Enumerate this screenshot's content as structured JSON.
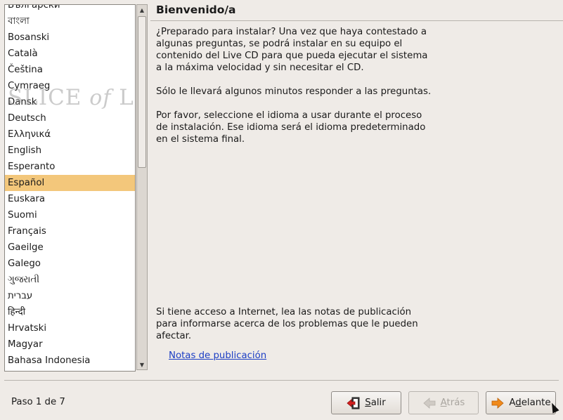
{
  "languages": {
    "items": [
      "Български",
      "বাংলা",
      "Bosanski",
      "Català",
      "Čeština",
      "Cymraeg",
      "Dansk",
      "Deutsch",
      "Ελληνικά",
      "English",
      "Esperanto",
      "Español",
      "Euskara",
      "Suomi",
      "Français",
      "Gaeilge",
      "Galego",
      "ગુજરાતી",
      "עברית",
      "हिन्दी",
      "Hrvatski",
      "Magyar",
      "Bahasa Indonesia"
    ],
    "selected": "Español"
  },
  "watermark": {
    "text_a": "SLICE ",
    "text_b": "of",
    "text_c": " LINUX"
  },
  "page": {
    "title": "Bienvenido/a",
    "paragraph_1": "¿Preparado para instalar? Una vez que haya contestado a algunas preguntas, se podrá instalar en su equipo el contenido del Live CD para que pueda ejecutar el sistema a la máxima velocidad y sin necesitar el CD.",
    "paragraph_2": "Sólo le llevará algunos minutos responder a las preguntas.",
    "paragraph_3": "Por favor, seleccione el idioma a usar durante el proceso de instalación. Ese idioma será el idioma predeterminado en el sistema final.",
    "paragraph_4": "Si tiene acceso a Internet, lea las notas de publicación para informarse acerca de los problemas que le pueden afectar.",
    "release_notes_link": "Notas de publicación"
  },
  "footer": {
    "step": "Paso 1 de 7",
    "quit_prefix": "",
    "quit_mnemonic": "S",
    "quit_rest": "alir",
    "back_prefix": "",
    "back_mnemonic": "A",
    "back_rest": "trás",
    "next_prefix": "A",
    "next_mnemonic": "d",
    "next_rest": "elante"
  },
  "colors": {
    "selection": "#f3c77b",
    "link": "#1c3ec4",
    "background": "#efebe7"
  },
  "icons": {
    "quit": "quit-door-icon",
    "back": "arrow-left-icon",
    "next": "arrow-right-icon"
  }
}
